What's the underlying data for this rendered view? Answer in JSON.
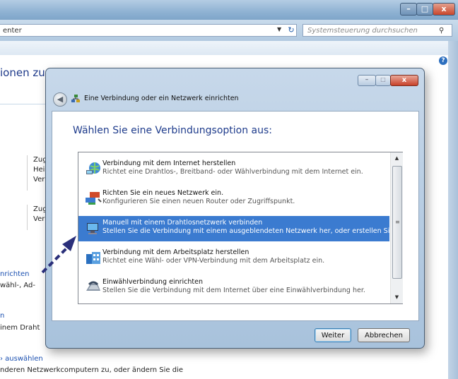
{
  "background_window": {
    "breadcrumb": "enter",
    "search_placeholder": "Systemsteuerung durchsuchen",
    "heading": "ionen zu",
    "box1": [
      "Zug",
      "Hei",
      "Ver"
    ],
    "box2": [
      "Zug",
      "Ver"
    ],
    "link_nrichten": "nrichten",
    "text_waehl": "wähl-, Ad-",
    "link_n": "n",
    "text_nem_draht": "inem Draht",
    "link_auswaehlen": "› auswählen",
    "text_bottom": "nderen Netzwerkcomputern zu, oder ändern Sie die"
  },
  "dialog": {
    "title": "Eine Verbindung oder ein Netzwerk einrichten",
    "heading": "Wählen Sie eine Verbindungsoption aus:",
    "options": [
      {
        "title": "Verbindung mit dem Internet herstellen",
        "desc": "Richtet eine Drahtlos-, Breitband- oder Wählverbindung mit dem Internet ein.",
        "icon": "globe-network-icon",
        "selected": false
      },
      {
        "title": "Richten Sie ein neues Netzwerk ein.",
        "desc": "Konfigurieren Sie einen neuen Router oder Zugriffspunkt.",
        "icon": "router-icon",
        "selected": false
      },
      {
        "title": "Manuell mit einem Drahtlosnetzwerk verbinden",
        "desc": "Stellen Sie die Verbindung mit einem ausgeblendeten Netzwerk her, oder erstellen Sie ei...",
        "icon": "wireless-computer-icon",
        "selected": true
      },
      {
        "title": "Verbindung mit dem Arbeitsplatz herstellen",
        "desc": "Richtet eine Wähl- oder VPN-Verbindung mit dem Arbeitsplatz ein.",
        "icon": "workplace-icon",
        "selected": false
      },
      {
        "title": "Einwählverbindung einrichten",
        "desc": "Stellen Sie die Verbindung mit dem Internet über eine Einwählverbindung her.",
        "icon": "dialup-modem-icon",
        "selected": false
      }
    ],
    "next_label": "Weiter",
    "cancel_label": "Abbrechen"
  },
  "colors": {
    "selection": "#3b7bd0",
    "heading": "#1f3c8c",
    "arrow": "#2a2f7a"
  }
}
